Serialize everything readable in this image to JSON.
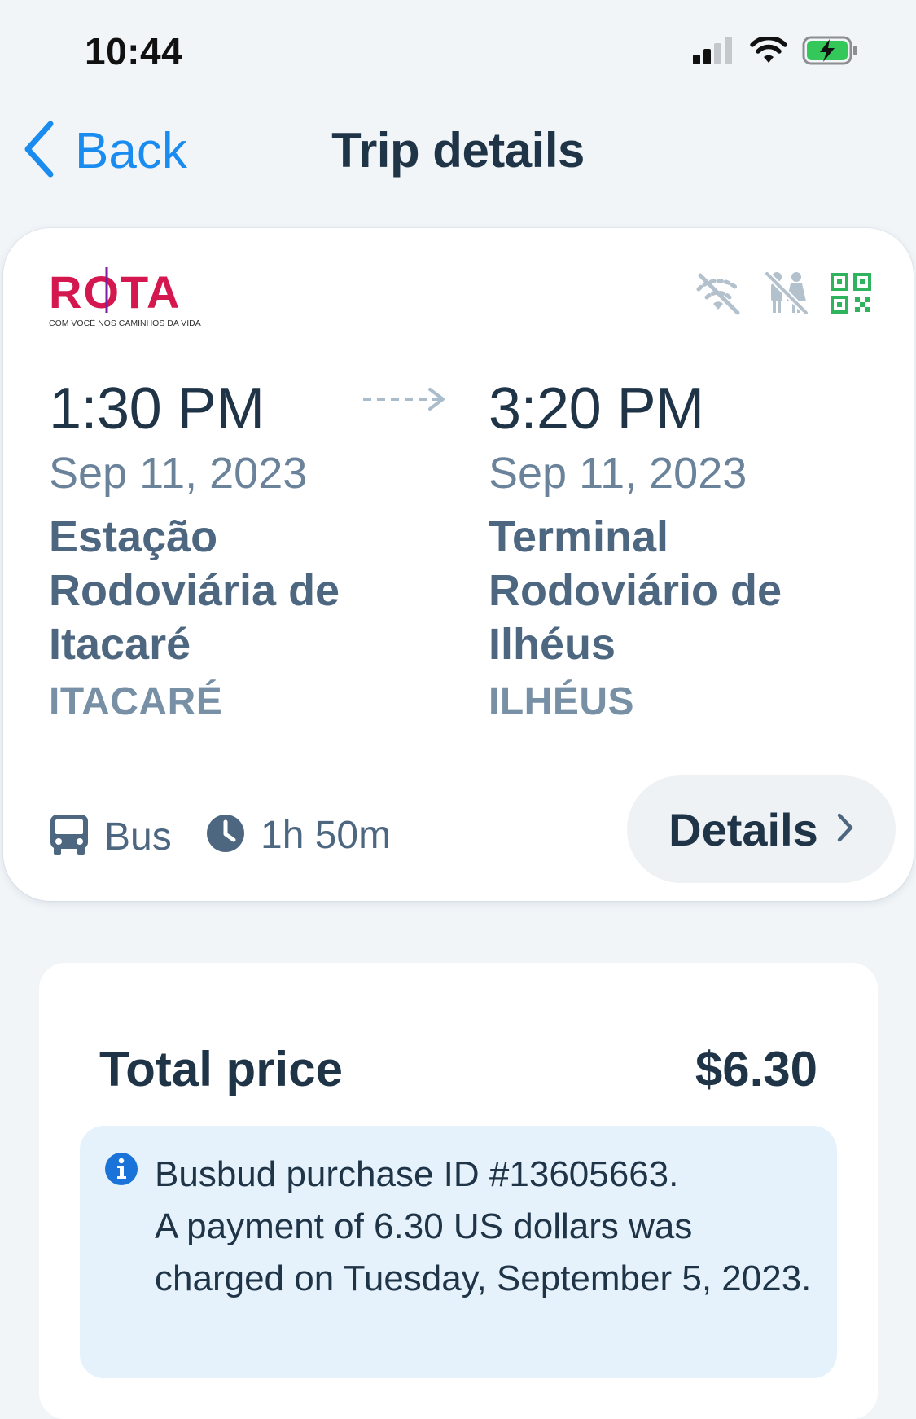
{
  "status_bar": {
    "time": "10:44",
    "icons": [
      "cellular-signal-icon",
      "wifi-icon",
      "battery-charging-icon"
    ]
  },
  "nav": {
    "back_label": "Back",
    "title": "Trip details"
  },
  "trip": {
    "operator": {
      "name": "ROTA",
      "tagline": "COM VOCÊ NOS CAMINHOS DA VIDA",
      "brand_color": "#d4184f"
    },
    "amenities": [
      {
        "name": "no-wifi-icon",
        "color": "#b3c1cd"
      },
      {
        "name": "no-restroom-icon",
        "color": "#b3c1cd"
      },
      {
        "name": "qr-code-icon",
        "color": "#2fb35c"
      }
    ],
    "departure": {
      "time": "1:30 PM",
      "date": "Sep 11, 2023",
      "station": "Estação Rodoviária de Itacaré",
      "city": "ITACARÉ"
    },
    "arrival": {
      "time": "3:20 PM",
      "date": "Sep 11, 2023",
      "station": "Terminal Rodoviário de Ilhéus",
      "city": "ILHÉUS"
    },
    "mode": "Bus",
    "duration": "1h 50m",
    "details_label": "Details"
  },
  "price": {
    "label": "Total price",
    "value": "$6.30",
    "info_line1": "Busbud purchase ID #13605663.",
    "info_line2": "A payment of 6.30 US dollars was charged on Tuesday, September 5, 2023."
  },
  "colors": {
    "accent": "#1a8cf0",
    "text_primary": "#1f3447",
    "text_secondary": "#6a839a",
    "info_bg": "#e5f2fb",
    "page_bg": "#f1f5f8"
  }
}
